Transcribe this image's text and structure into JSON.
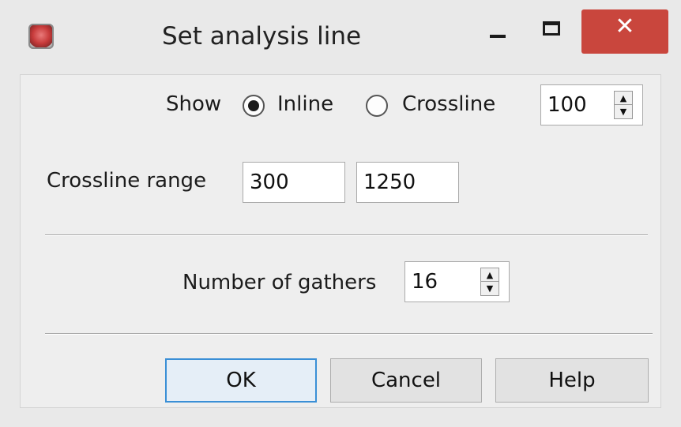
{
  "window": {
    "title": "Set analysis line",
    "icon": "app-icon",
    "controls": {
      "minimize": "minimize-icon",
      "maximize": "maximize-icon",
      "close": "✕"
    }
  },
  "show": {
    "label": "Show",
    "options": [
      {
        "label": "Inline",
        "selected": true
      },
      {
        "label": "Crossline",
        "selected": false
      }
    ],
    "line_number": "100"
  },
  "crossline_range": {
    "label": "Crossline range",
    "from": "300",
    "to": "1250"
  },
  "gathers": {
    "label": "Number of gathers",
    "value": "16"
  },
  "buttons": {
    "ok": "OK",
    "cancel": "Cancel",
    "help": "Help"
  },
  "colors": {
    "close_button": "#c9463d",
    "default_button_border": "#3a8fd6"
  }
}
